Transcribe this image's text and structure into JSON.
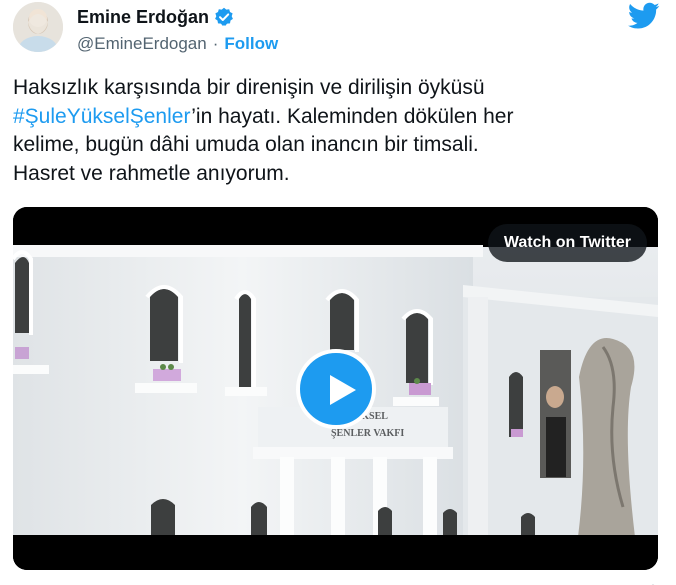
{
  "author": {
    "display_name": "Emine Erdoğan",
    "handle": "@EmineErdogan",
    "separator": "·",
    "follow_label": "Follow",
    "verified_icon": "verified-badge-icon",
    "brand_icon": "twitter-bird-icon"
  },
  "tweet": {
    "line1": "Haksızlık karşısında bir direnişin ve dirilişin öyküsü",
    "hashtag": "#ŞuleYükselŞenler",
    "line2_rest": "’in hayatı. Kaleminden dökülen her",
    "line3": "kelime, bugün dâhi umuda olan inancın bir timsali.",
    "line4": "Hasret ve rahmetle anıyorum."
  },
  "media": {
    "watch_label": "Watch on Twitter",
    "play_icon": "play-icon",
    "building_sign": "E YÜKSEL\nŞENLER VAKFI"
  },
  "colors": {
    "accent": "#1d9bf0",
    "text": "#0f1419",
    "secondary": "#536471"
  }
}
